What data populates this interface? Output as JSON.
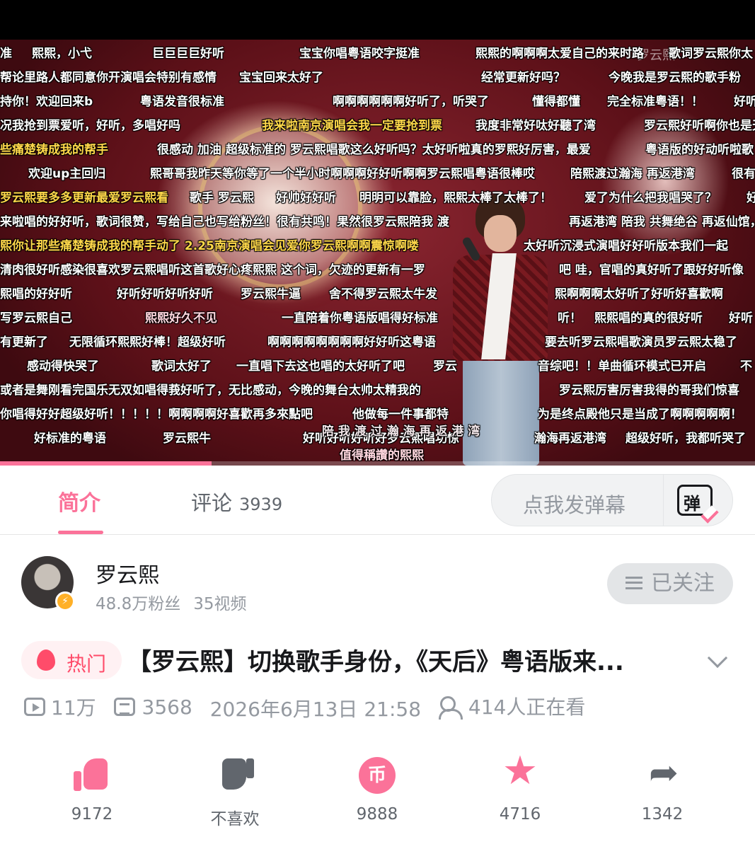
{
  "video": {
    "watermark": "罗云熙",
    "overlay_lyric": "陪 我 渡 过 瀚 海 再 返 港 湾",
    "progress_percent": 28,
    "danmaku": [
      {
        "text": "准",
        "cls": ""
      },
      {
        "text": "熙熙，小弋",
        "cls": ""
      },
      {
        "text": "巨巨巨巨好听",
        "cls": ""
      },
      {
        "text": "宝宝你唱粤语咬字挺准",
        "cls": ""
      },
      {
        "text": "熙熙的啊啊啊太爱自己的来时路",
        "cls": ""
      },
      {
        "text": "歌词罗云熙你太",
        "cls": ""
      },
      {
        "text": "帮论里路人都同意你开演唱会特别有感情",
        "cls": ""
      },
      {
        "text": "宝宝回来太好了",
        "cls": ""
      },
      {
        "text": "经常更新好吗？",
        "cls": ""
      },
      {
        "text": "今晚我是罗云熙的歌手粉",
        "cls": ""
      },
      {
        "text": "持你！欢迎回来b",
        "cls": ""
      },
      {
        "text": "粤语发音很标准",
        "cls": ""
      },
      {
        "text": "啊啊啊啊啊啊好听了，听哭了",
        "cls": ""
      },
      {
        "text": "懂得都懂",
        "cls": ""
      },
      {
        "text": "完全标准粤语！！",
        "cls": ""
      },
      {
        "text": "好听",
        "cls": ""
      },
      {
        "text": "况我抢到票爱听，好听，多唱好吗",
        "cls": ""
      },
      {
        "text": "我来啦南京演唱会我一定要抢到票",
        "cls": "yellow"
      },
      {
        "text": "我度非常好呔好聽了湾",
        "cls": ""
      },
      {
        "text": "罗云熙好听啊你也是天",
        "cls": ""
      },
      {
        "text": "些痛楚铸成我的帮手",
        "cls": "yellow"
      },
      {
        "text": "很感动 加油 超级标准的 罗云熙唱歌这么好听吗？太好听啦真的罗熙好厉害，最爱",
        "cls": ""
      },
      {
        "text": "粤语版的好动听啦歌",
        "cls": ""
      },
      {
        "text": "欢迎up主回归",
        "cls": ""
      },
      {
        "text": "熙哥哥我昨天等你等了一个半小时啊啊啊好好听啊啊罗云熙唱粤语很棒哎",
        "cls": ""
      },
      {
        "text": "陪熙渡过瀚海 再返港湾",
        "cls": ""
      },
      {
        "text": "很有",
        "cls": ""
      },
      {
        "text": "罗云熙要多多更新最爱罗云熙看",
        "cls": "yellow"
      },
      {
        "text": "歌手 罗云熙",
        "cls": ""
      },
      {
        "text": "好帅好好听",
        "cls": ""
      },
      {
        "text": "明明可以靠脸，熙熙太棒了太棒了！",
        "cls": ""
      },
      {
        "text": "爱了为什么把我唱哭了？",
        "cls": ""
      },
      {
        "text": "好",
        "cls": ""
      },
      {
        "text": "来啦唱的好好听，歌词很赞，写给自己也写给粉丝！很有共鸣！果然很罗云熙陪我 渡",
        "cls": ""
      },
      {
        "text": "再返港湾 陪我 共舞绝谷 再返仙馆，久",
        "cls": ""
      },
      {
        "text": "熙你让那些痛楚铸成我的帮手动了 2.25南京演唱会见爱你罗云熙啊啊震惊啊喽",
        "cls": "yellow"
      },
      {
        "text": "太好听沉浸式演唱好好听版本我们一起",
        "cls": ""
      },
      {
        "text": "清肉很好听感染很喜欢罗云熙唱听这首歌好心疼熙熙 这个词，欠迹的更新有一罗",
        "cls": ""
      },
      {
        "text": "吧 哇，官唱的真好听了跟好好听像",
        "cls": ""
      },
      {
        "text": "熙唱的好好听",
        "cls": ""
      },
      {
        "text": "好听好听好听好听",
        "cls": ""
      },
      {
        "text": "罗云熙牛逼",
        "cls": ""
      },
      {
        "text": "舍不得罗云熙太牛发",
        "cls": ""
      },
      {
        "text": "熙啊啊啊太好听了好听好喜歡啊",
        "cls": ""
      },
      {
        "text": "写罗云熙自己",
        "cls": ""
      },
      {
        "text": "熙熙好久不见",
        "cls": "pinkbox"
      },
      {
        "text": "一直陪着你粤语版唱得好标准",
        "cls": ""
      },
      {
        "text": "听！",
        "cls": ""
      },
      {
        "text": "熙熙唱的真的很好听",
        "cls": ""
      },
      {
        "text": "好听",
        "cls": ""
      },
      {
        "text": "有更新了",
        "cls": ""
      },
      {
        "text": "无限循环熙熙好棒！超级好听",
        "cls": ""
      },
      {
        "text": "啊啊啊啊啊啊啊啊好好听这粤语",
        "cls": ""
      },
      {
        "text": "要去听罗云熙唱歌演员罗云熙太稳了",
        "cls": ""
      },
      {
        "text": "感动得快哭了",
        "cls": ""
      },
      {
        "text": "歌词太好了",
        "cls": ""
      },
      {
        "text": "一直唱下去这也唱的太好听了吧",
        "cls": ""
      },
      {
        "text": "罗云",
        "cls": ""
      },
      {
        "text": "音综吧！！单曲循环模式已开启",
        "cls": ""
      },
      {
        "text": "不",
        "cls": ""
      },
      {
        "text": "或者是舞刚看完国乐无双如唱得莪好听了，无比感动，今晚的舞台太帅太精我的",
        "cls": ""
      },
      {
        "text": "罗云熙厉害厉害我得的哥我们惊喜",
        "cls": ""
      },
      {
        "text": "你唱得好好超级好听！！！！！啊啊啊啊好喜歡再多來點吧",
        "cls": ""
      },
      {
        "text": "他做每一件事都特",
        "cls": ""
      },
      {
        "text": "为是终点殿他只是当成了啊啊啊啊啊！",
        "cls": ""
      },
      {
        "text": "好标准的粤语",
        "cls": ""
      },
      {
        "text": "罗云熙牛",
        "cls": ""
      },
      {
        "text": "好听好听好听好罗云熙唱功惊",
        "cls": ""
      },
      {
        "text": "瀚海再返港湾",
        "cls": ""
      },
      {
        "text": "超级好听，我都听哭了",
        "cls": ""
      },
      {
        "text": "值得稱讚的熙熙",
        "cls": "pinkbox"
      }
    ]
  },
  "tabs": {
    "intro_label": "简介",
    "comments_label": "评论",
    "comments_count": "3939",
    "danmaku_placeholder": "点我发弹幕",
    "danmaku_icon_char": "弹"
  },
  "uploader": {
    "name": "罗云熙",
    "followers": "48.8万粉丝",
    "videos": "35视频",
    "follow_label": "已关注"
  },
  "title": {
    "hot_label": "热门",
    "text": "【罗云熙】切换歌手身份，《天后》粤语版来..."
  },
  "meta": {
    "views": "11万",
    "danmaku_count": "3568",
    "datetime": "2026年6月13日 21:58",
    "watching": "414人正在看"
  },
  "actions": {
    "like_count": "9172",
    "dislike_label": "不喜欢",
    "coin_count": "9888",
    "coin_glyph": "币",
    "favorite_count": "4716",
    "share_count": "1342"
  },
  "colors": {
    "accent": "#fb7299",
    "text_secondary": "#9499a0"
  }
}
